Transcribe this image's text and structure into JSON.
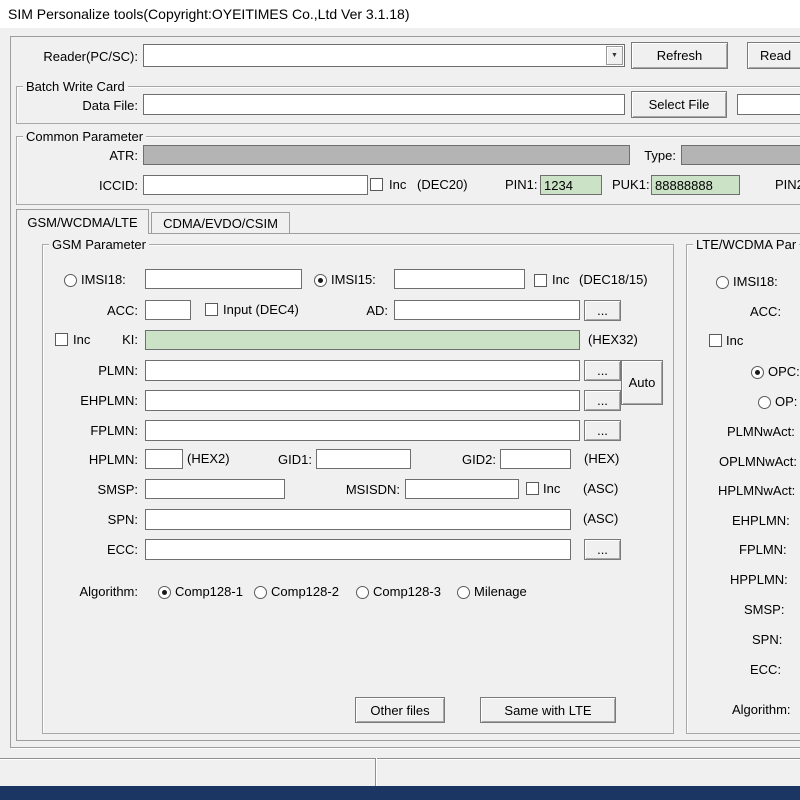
{
  "window": {
    "title": "SIM Personalize tools(Copyright:OYEITIMES Co.,Ltd Ver 3.1.18)"
  },
  "icons": {
    "dropdown_arrow": "▼"
  },
  "colors": {
    "field_green": "#cbe2c6",
    "field_gray": "#b4b4b4",
    "taskbar_navy": "#1c3663"
  },
  "reader": {
    "label": "Reader(PC/SC):",
    "value": "",
    "refresh_button": "Refresh",
    "read_button": "Read"
  },
  "batch": {
    "title": "Batch Write Card",
    "data_file_label": "Data File:",
    "data_file_value": "",
    "extra_value": "",
    "select_file_button": "Select File"
  },
  "common": {
    "title": "Common Parameter",
    "atr_label": "ATR:",
    "atr_value": "",
    "type_label": "Type:",
    "type_value": "",
    "iccid_label": "ICCID:",
    "iccid_value": "",
    "inc_label": "Inc",
    "dec20_label": "(DEC20)",
    "pin1_label": "PIN1:",
    "pin1_value": "1234",
    "puk1_label": "PUK1:",
    "puk1_value": "88888888",
    "pin2_label": "PIN2"
  },
  "tabs": {
    "gsm": "GSM/WCDMA/LTE",
    "cdma": "CDMA/EVDO/CSIM"
  },
  "gsm": {
    "title": "GSM Parameter",
    "imsi18_label": "IMSI18:",
    "imsi18_value": "",
    "imsi15_label": "IMSI15:",
    "imsi15_value": "",
    "inc1_label": "Inc",
    "dec1815_label": "(DEC18/15)",
    "acc_label": "ACC:",
    "acc_value": "",
    "input_dec4_label": "Input (DEC4)",
    "ad_label": "AD:",
    "ad_value": "",
    "inc_ki_label": "Inc",
    "ki_label": "KI:",
    "ki_value": "",
    "hex32_label": "(HEX32)",
    "plmn_label": "PLMN:",
    "plmn_value": "",
    "auto_button": "Auto",
    "ehplmn_label": "EHPLMN:",
    "ehplmn_value": "",
    "fplmn_label": "FPLMN:",
    "fplmn_value": "",
    "hplmn_label": "HPLMN:",
    "hplmn_value": "",
    "hex2_label": "(HEX2)",
    "gid1_label": "GID1:",
    "gid1_value": "",
    "gid2_label": "GID2:",
    "gid2_value": "",
    "hex_label": "(HEX)",
    "smsp_label": "SMSP:",
    "smsp_value": "",
    "msisdn_label": "MSISDN:",
    "msisdn_value": "",
    "inc_msisdn_label": "Inc",
    "asc1_label": "(ASC)",
    "spn_label": "SPN:",
    "spn_value": "",
    "asc2_label": "(ASC)",
    "ecc_label": "ECC:",
    "ecc_value": "",
    "algorithm_label": "Algorithm:",
    "alg_comp1": "Comp128-1",
    "alg_comp2": "Comp128-2",
    "alg_comp3": "Comp128-3",
    "alg_milenage": "Milenage",
    "other_files_button": "Other files",
    "same_with_lte_button": "Same with LTE",
    "browse_button": "..."
  },
  "lte": {
    "title": "LTE/WCDMA Par",
    "imsi18_label": "IMSI18:",
    "acc_label": "ACC:",
    "inc_label": "Inc",
    "opc_label": "OPC:",
    "op_label": "OP:",
    "plmnwact_label": "PLMNwAct:",
    "oplmnwact_label": "OPLMNwAct:",
    "hplmnwact_label": "HPLMNwAct:",
    "ehplmn_label": "EHPLMN:",
    "fplmn_label": "FPLMN:",
    "hpplmn_label": "HPPLMN:",
    "smsp_label": "SMSP:",
    "spn_label": "SPN:",
    "ecc_label": "ECC:",
    "algorithm_label": "Algorithm:"
  }
}
